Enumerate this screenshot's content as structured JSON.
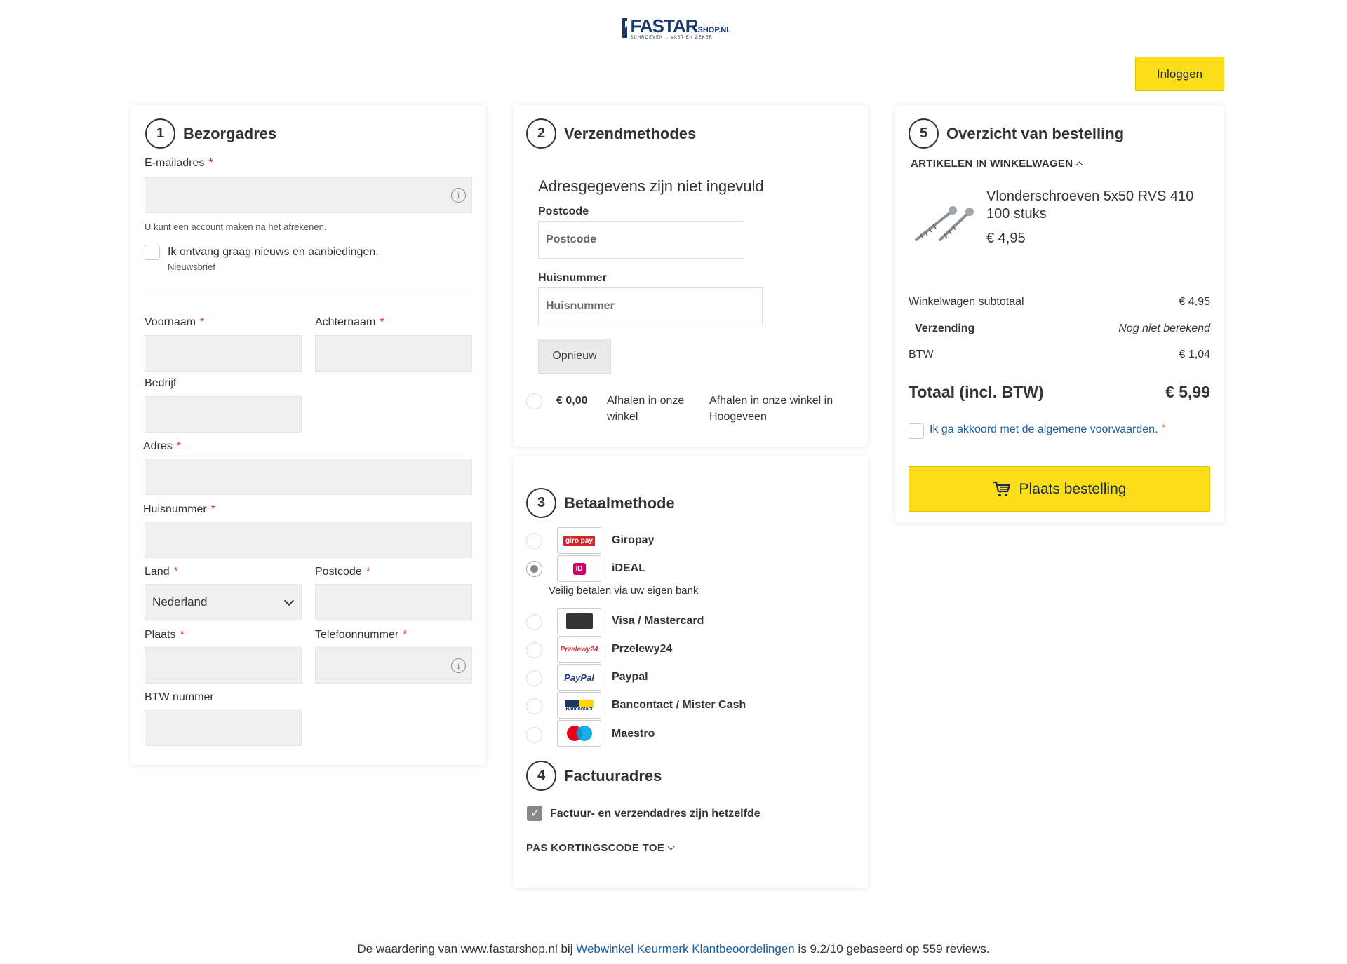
{
  "header": {
    "logo_main": "FASTAR",
    "logo_small": "SHOP.NL",
    "logo_sub": "SCHROEVEN... VAST EN ZEKER",
    "login_label": "Inloggen"
  },
  "address": {
    "step": "1",
    "title": "Bezorgadres",
    "email_label": "E-mailadres",
    "email_help": "U kunt een account maken na het afrekenen.",
    "newsletter_label": "Ik ontvang graag nieuws en aanbiedingen.",
    "newsletter_sub": "Nieuwsbrief",
    "firstname_label": "Voornaam",
    "lastname_label": "Achternaam",
    "company_label": "Bedrijf",
    "street_label": "Adres",
    "housenumber_label": "Huisnummer",
    "country_label": "Land",
    "country_value": "Nederland",
    "postcode_label": "Postcode",
    "city_label": "Plaats",
    "phone_label": "Telefoonnummer",
    "vat_label": "BTW nummer",
    "required_mark": "*",
    "info_glyph": "i"
  },
  "shipping": {
    "step": "2",
    "title": "Verzendmethodes",
    "notice": "Adresgegevens zijn niet ingevuld",
    "postcode_label": "Postcode",
    "postcode_placeholder": "Postcode",
    "housenumber_label": "Huisnummer",
    "housenumber_placeholder": "Huisnummer",
    "retry_label": "Opnieuw",
    "method_price": "€ 0,00",
    "method_name": "Afhalen in onze winkel",
    "method_desc": "Afhalen in onze winkel in Hoogeveen"
  },
  "payment": {
    "step": "3",
    "title": "Betaalmethode",
    "methods": [
      {
        "label": "Giropay",
        "logo": "giro pay"
      },
      {
        "label": "iDEAL",
        "logo": "iD"
      },
      {
        "label": "Visa / Mastercard",
        "logo": "card"
      },
      {
        "label": "Przelewy24",
        "logo": "Przelewy24"
      },
      {
        "label": "Paypal",
        "logo": "PayPal"
      },
      {
        "label": "Bancontact / Mister Cash",
        "logo": "Bancontact"
      },
      {
        "label": "Maestro",
        "logo": "maestro"
      }
    ],
    "ideal_note": "Veilig betalen via uw eigen bank"
  },
  "billing": {
    "step": "4",
    "title": "Factuuradres",
    "same_label": "Factuur- en verzendadres zijn hetzelfde",
    "coupon_label": "PAS KORTINGSCODE TOE"
  },
  "summary": {
    "step": "5",
    "title": "Overzicht van bestelling",
    "cart_caption": "ARTIKELEN IN WINKELWAGEN",
    "product_name": "Vlonderschroeven 5x50 RVS 410 100 stuks",
    "product_price": "€ 4,95",
    "subtotal_label": "Winkelwagen subtotaal",
    "subtotal_value": "€ 4,95",
    "shipping_label": "Verzending",
    "shipping_value": "Nog niet berekend",
    "vat_label": "BTW",
    "vat_value": "€ 1,04",
    "total_label": "Totaal (incl. BTW)",
    "total_value": "€ 5,99",
    "agree_label": "Ik ga akkoord met de algemene voorwaarden.",
    "place_order_label": "Plaats bestelling"
  },
  "footer": {
    "prefix": "De waardering van www.fastarshop.nl bij",
    "link": "Webwinkel Keurmerk Klantbeoordelingen",
    "suffix": "is 9.2/10 gebaseerd op 559 reviews."
  },
  "colors": {
    "accent": "#fcdd1a",
    "link": "#1a5fa0",
    "brand": "#1a3a6b",
    "required": "#e02b27"
  }
}
